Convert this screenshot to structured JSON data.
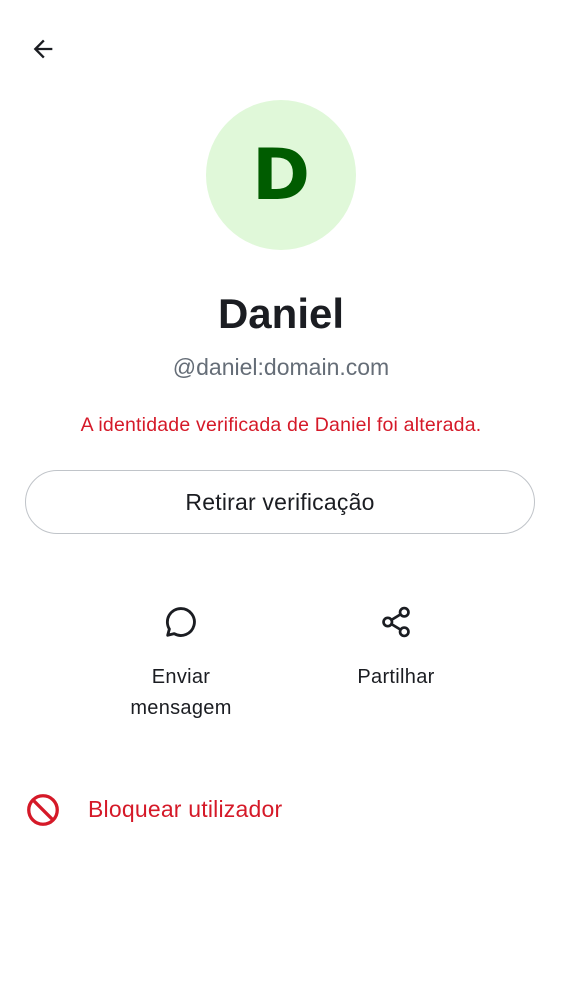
{
  "header": {
    "back_icon": "arrow-left-icon"
  },
  "profile": {
    "avatar_initial": "D",
    "avatar_bg_color": "#e0f8d9",
    "avatar_fg_color": "#005c00",
    "display_name": "Daniel",
    "user_id": "@daniel:domain.com",
    "warning_text": "A identidade verificada de Daniel foi alterada.",
    "warning_color": "#d51928"
  },
  "withdraw_button": {
    "label": "Retirar verificação"
  },
  "actions": {
    "message": {
      "icon": "chat-bubble-icon",
      "label_line1": "Enviar",
      "label_line2": "mensagem"
    },
    "share": {
      "icon": "share-icon",
      "label": "Partilhar"
    }
  },
  "block": {
    "icon": "block-icon",
    "label": "Bloquear utilizador",
    "color": "#d51928"
  }
}
